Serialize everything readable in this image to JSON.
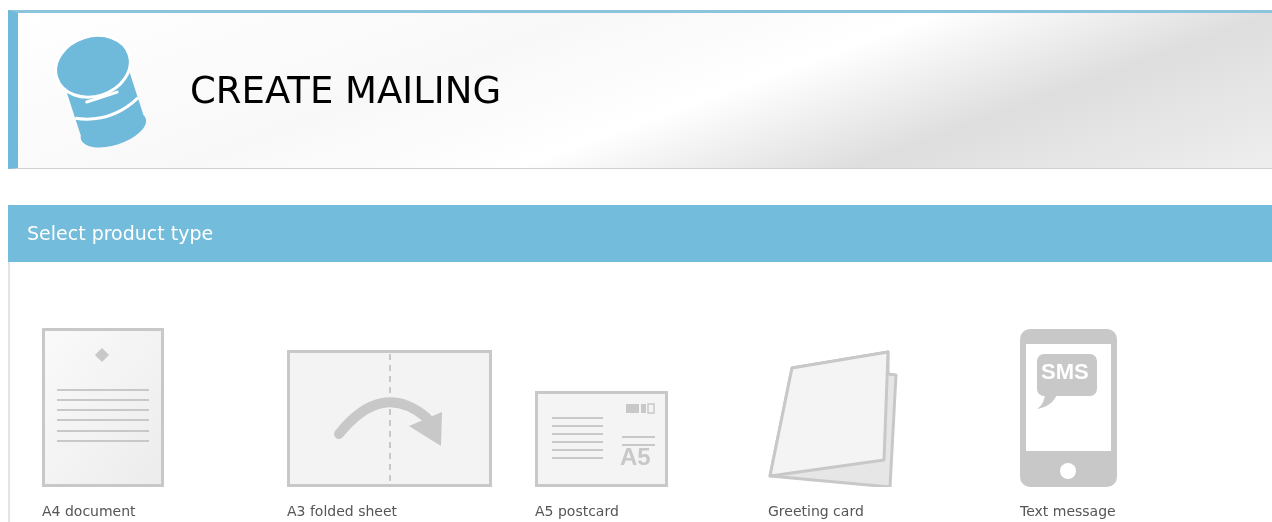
{
  "header": {
    "title": "CREATE MAILING"
  },
  "section": {
    "title": "Select product type"
  },
  "products": [
    {
      "kind": "a4",
      "label": "A4 document"
    },
    {
      "kind": "a3",
      "label": "A3 folded sheet"
    },
    {
      "kind": "a5",
      "label": "A5 postcard",
      "icon_text": "A5"
    },
    {
      "kind": "card",
      "label": "Greeting card"
    },
    {
      "kind": "sms",
      "label": "Text message",
      "icon_text": "SMS"
    }
  ]
}
